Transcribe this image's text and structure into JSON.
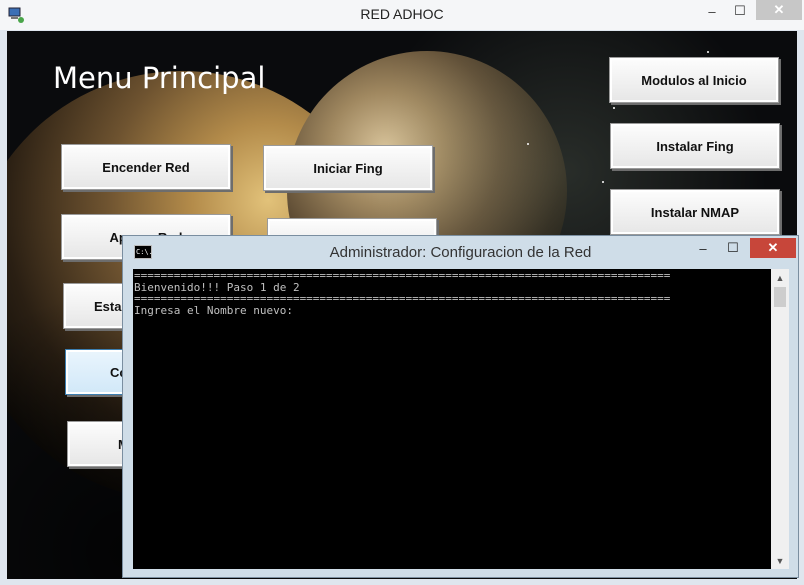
{
  "main_window": {
    "title": "RED ADHOC",
    "controls": {
      "minimize": "–",
      "maximize": "☐",
      "close": "✕"
    },
    "app_icon": "network-computer-icon"
  },
  "menu": {
    "title": "Menu Principal",
    "buttons": {
      "encender_red": "Encender Red",
      "apagar_red": "Apagar Red",
      "estado": "Esta",
      "config": "Co",
      "fifth": "M",
      "iniciar_fing": "Iniciar Fing",
      "modulos_inicio": "Modulos al Inicio",
      "instalar_fing": "Instalar Fing",
      "instalar_nmap": "Instalar NMAP"
    }
  },
  "console_window": {
    "title": "Administrador:  Configuracion de la Red",
    "icon_label": "C:\\.",
    "controls": {
      "minimize": "–",
      "maximize": "☐",
      "close": "✕"
    },
    "lines": [
      "=================================================================================",
      "Bienvenido!!! Paso 1 de 2",
      "=================================================================================",
      "Ingresa el Nombre nuevo:"
    ],
    "scroll_up": "▲",
    "scroll_down": "▼"
  },
  "colors": {
    "console_bg": "#000000",
    "console_text": "#c0c0c0",
    "close_red": "#c7463a",
    "active_button": "#d1e8f8"
  }
}
